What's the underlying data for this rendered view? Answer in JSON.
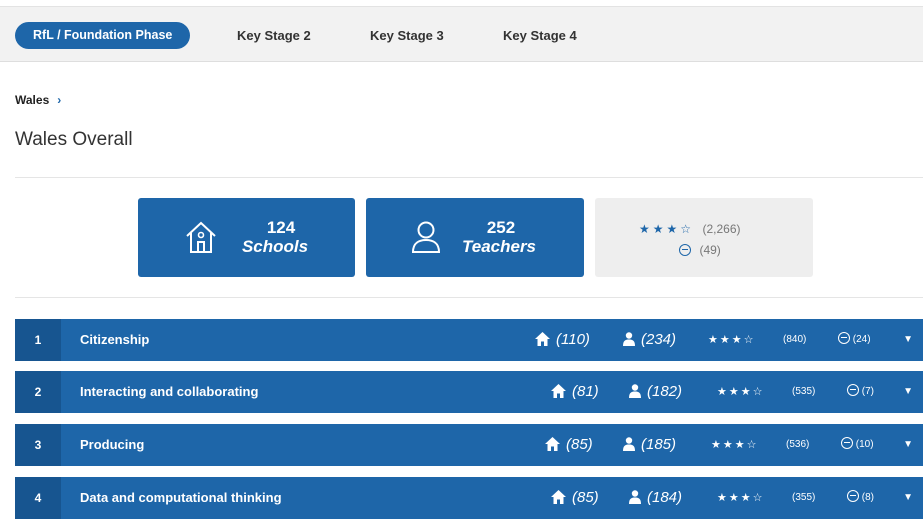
{
  "tabs": [
    {
      "label": "RfL / Foundation Phase",
      "active": true
    },
    {
      "label": "Key Stage 2",
      "active": false
    },
    {
      "label": "Key Stage 3",
      "active": false
    },
    {
      "label": "Key Stage 4",
      "active": false
    }
  ],
  "breadcrumb": {
    "label": "Wales",
    "separator": "›"
  },
  "page_title": "Wales Overall",
  "summary": {
    "schools": {
      "count": "124",
      "label": "Schools",
      "icon": "house-icon"
    },
    "teachers": {
      "count": "252",
      "label": "Teachers",
      "icon": "person-icon"
    },
    "rating": {
      "stars_filled": 3,
      "stars_total": 4,
      "reviews": "(2,266)",
      "comments": "(49)"
    }
  },
  "rows": [
    {
      "index": "1",
      "name": "Citizenship",
      "schools": "(110)",
      "teachers": "(234)",
      "stars_filled": 3,
      "reviews": "(840)",
      "comments": "(24)"
    },
    {
      "index": "2",
      "name": "Interacting and collaborating",
      "schools": "(81)",
      "teachers": "(182)",
      "stars_filled": 3,
      "reviews": "(535)",
      "comments": "(7)"
    },
    {
      "index": "3",
      "name": "Producing",
      "schools": "(85)",
      "teachers": "(185)",
      "stars_filled": 3,
      "reviews": "(536)",
      "comments": "(10)"
    },
    {
      "index": "4",
      "name": "Data and computational thinking",
      "schools": "(85)",
      "teachers": "(184)",
      "stars_filled": 3,
      "reviews": "(355)",
      "comments": "(8)"
    }
  ],
  "colors": {
    "primary": "#1e66a9",
    "index_bg": "#175590",
    "tabbar_bg": "#f2f2f2",
    "rating_bg": "#eeeeee"
  }
}
